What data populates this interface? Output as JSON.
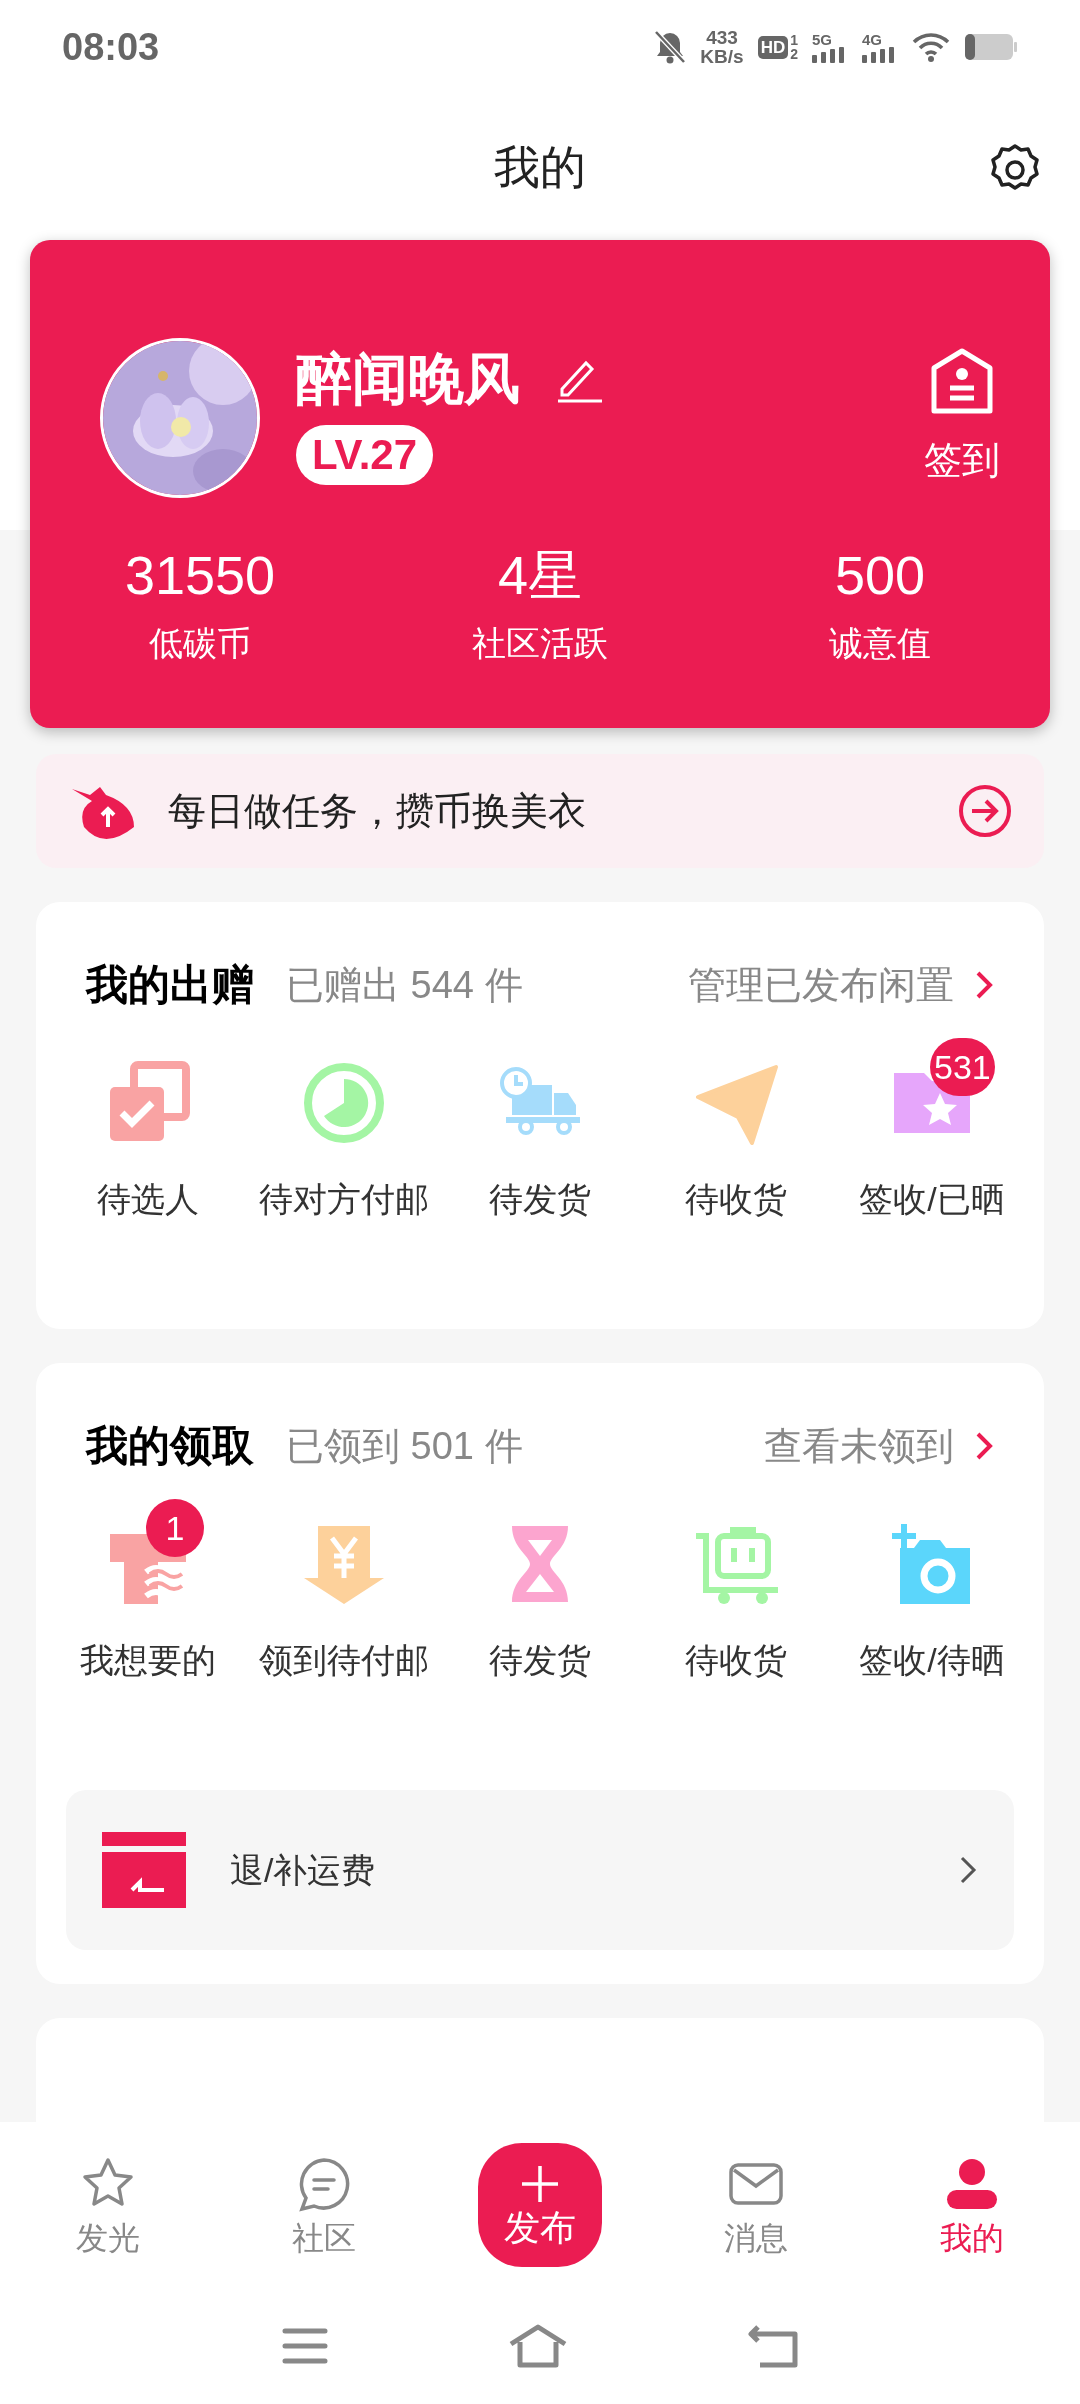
{
  "status_bar": {
    "time": "08:03",
    "speed": [
      "433",
      "KB/s"
    ],
    "hd": "HD",
    "sims": [
      "1",
      "2"
    ],
    "networks": [
      "5G",
      "4G"
    ]
  },
  "title": "我的",
  "profile": {
    "name": "醉闻晚风",
    "level": "LV.27",
    "checkin": "签到",
    "stats": [
      {
        "value": "31550",
        "label": "低碳币"
      },
      {
        "value": "4星",
        "label": "社区活跃"
      },
      {
        "value": "500",
        "label": "诚意值"
      }
    ]
  },
  "banner": {
    "text": "每日做任务，攒币换美衣"
  },
  "sections": [
    {
      "title": "我的出赠",
      "count": "已赠出 544 件",
      "link": "管理已发布闲置",
      "items": [
        {
          "kind": "checklist",
          "label": "待选人"
        },
        {
          "kind": "clock",
          "label": "待对方付邮"
        },
        {
          "kind": "truck",
          "label": "待发货"
        },
        {
          "kind": "plane",
          "label": "待收货"
        },
        {
          "kind": "folder",
          "label": "签收/已晒",
          "badge": "531"
        }
      ]
    },
    {
      "title": "我的领取",
      "count": "已领到 501 件",
      "link": "查看未领到",
      "items": [
        {
          "kind": "shirt",
          "label": "我想要的",
          "badge": "1"
        },
        {
          "kind": "yen",
          "label": "领到待付邮"
        },
        {
          "kind": "hourglass",
          "label": "待发货"
        },
        {
          "kind": "cart",
          "label": "待收货"
        },
        {
          "kind": "camera",
          "label": "签收/待晒"
        }
      ],
      "row": {
        "label": "退/补运费"
      }
    }
  ],
  "nav": [
    {
      "kind": "star",
      "label": "发光",
      "selected": false
    },
    {
      "kind": "chat",
      "label": "社区",
      "selected": false
    },
    {
      "kind": "publish",
      "label": "发布",
      "selected": false
    },
    {
      "kind": "mail",
      "label": "消息",
      "selected": false
    },
    {
      "kind": "person",
      "label": "我的",
      "selected": true
    }
  ]
}
